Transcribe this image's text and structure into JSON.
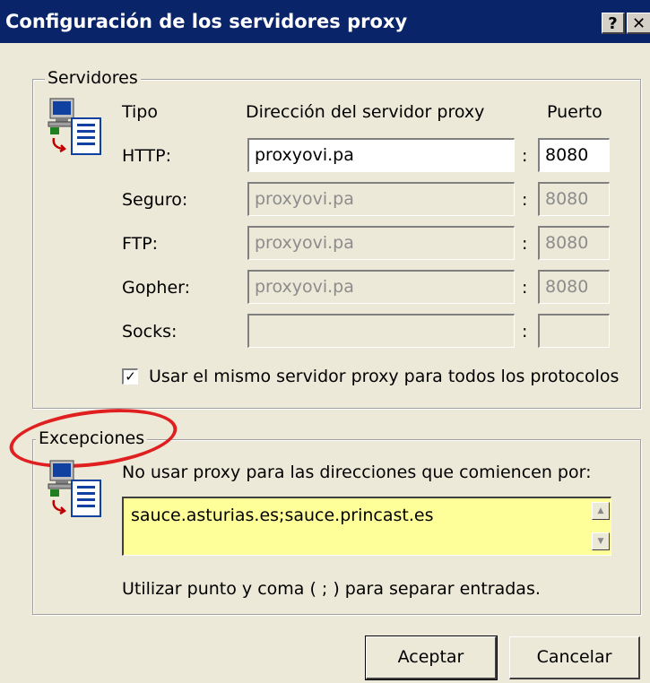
{
  "window": {
    "title": "Configuración de los servidores proxy",
    "help_label": "?",
    "close_label": "✕"
  },
  "servers": {
    "group_label": "Servidores",
    "icon": "network-document-icon",
    "headers": {
      "type": "Tipo",
      "address": "Dirección del servidor proxy",
      "port": "Puerto"
    },
    "rows": [
      {
        "label": "HTTP:",
        "address": "proxyovi.pa",
        "port": "8080",
        "enabled": true
      },
      {
        "label": "Seguro:",
        "address": "proxyovi.pa",
        "port": "8080",
        "enabled": false
      },
      {
        "label": "FTP:",
        "address": "proxyovi.pa",
        "port": "8080",
        "enabled": false
      },
      {
        "label": "Gopher:",
        "address": "proxyovi.pa",
        "port": "8080",
        "enabled": false
      },
      {
        "label": "Socks:",
        "address": "",
        "port": "",
        "enabled": false
      }
    ],
    "separator": ":",
    "same_proxy_checked": true,
    "same_proxy_label": "Usar el mismo servidor proxy para todos los protocolos"
  },
  "exceptions": {
    "group_label": "Excepciones",
    "icon": "network-document-icon",
    "instruction": "No usar proxy para las direcciones que comiencen por:",
    "value": "sauce.asturias.es;sauce.princast.es",
    "hint": "Utilizar punto y coma ( ; ) para separar entradas.",
    "highlight_color": "#ffff99",
    "annotation_color": "#e02020"
  },
  "buttons": {
    "ok": "Aceptar",
    "cancel": "Cancelar"
  },
  "colors": {
    "titlebar": "#0a246a",
    "dialog": "#ece9d8"
  }
}
